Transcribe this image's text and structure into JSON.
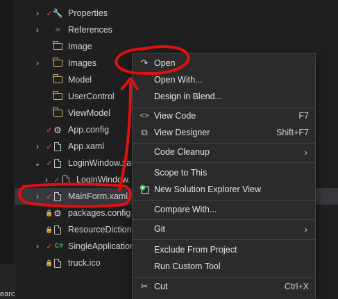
{
  "tree": {
    "items": [
      {
        "label": "Properties",
        "icon": "wrench-icon"
      },
      {
        "label": "References",
        "icon": "references-icon"
      },
      {
        "label": "Image",
        "icon": "folder-icon"
      },
      {
        "label": "Images",
        "icon": "folder-icon"
      },
      {
        "label": "Model",
        "icon": "folder-icon"
      },
      {
        "label": "UserControl",
        "icon": "folder-icon"
      },
      {
        "label": "ViewModel",
        "icon": "folder-icon"
      },
      {
        "label": "App.config",
        "icon": "config-icon"
      },
      {
        "label": "App.xaml",
        "icon": "xaml-file-icon"
      },
      {
        "label": "LoginWindow.xan",
        "icon": "xaml-file-icon"
      },
      {
        "label": "LoginWindow.",
        "icon": "xaml-file-icon"
      },
      {
        "label": "MainForm.xaml",
        "icon": "xaml-file-icon"
      },
      {
        "label": "packages.config",
        "icon": "config-icon"
      },
      {
        "label": "ResourceDictiona",
        "icon": "xaml-file-icon"
      },
      {
        "label": "SingleApplication",
        "icon": "csharp-file-icon"
      },
      {
        "label": "truck.ico",
        "icon": "image-file-icon"
      }
    ],
    "chevron": "›",
    "chevron_open": "⌄",
    "check_glyph": "✓",
    "lock_glyph": "🔒",
    "cs_glyph": "C#"
  },
  "rail": {
    "text": "earc"
  },
  "context_menu": {
    "items": [
      {
        "label": "Open",
        "icon": "open-arrow-icon",
        "glyph": "↷",
        "shortcut": ""
      },
      {
        "label": "Open With...",
        "icon": "",
        "glyph": "",
        "shortcut": ""
      },
      {
        "label": "Design in Blend...",
        "icon": "",
        "glyph": "",
        "shortcut": ""
      },
      {
        "label": "View Code",
        "icon": "code-icon",
        "glyph": "<>",
        "shortcut": "F7"
      },
      {
        "label": "View Designer",
        "icon": "designer-icon",
        "glyph": "⧉",
        "shortcut": "Shift+F7"
      },
      {
        "label": "Code Cleanup",
        "icon": "",
        "glyph": "",
        "shortcut": "",
        "submenu": "›"
      },
      {
        "label": "Scope to This",
        "icon": "",
        "glyph": "",
        "shortcut": ""
      },
      {
        "label": "New Solution Explorer View",
        "icon": "new-view-icon",
        "glyph": "",
        "shortcut": ""
      },
      {
        "label": "Compare With...",
        "icon": "",
        "glyph": "",
        "shortcut": ""
      },
      {
        "label": "Git",
        "icon": "",
        "glyph": "",
        "shortcut": "",
        "submenu": "›"
      },
      {
        "label": "Exclude From Project",
        "icon": "",
        "glyph": "",
        "shortcut": ""
      },
      {
        "label": "Run Custom Tool",
        "icon": "",
        "glyph": "",
        "shortcut": ""
      },
      {
        "label": "Cut",
        "icon": "scissors-icon",
        "glyph": "✂",
        "shortcut": "Ctrl+X"
      }
    ]
  },
  "colors": {
    "background": "#1f1f1f",
    "menu_background": "#2b2b2b",
    "annotation_red": "#e01010",
    "check_red": "#e5534b",
    "folder_yellow": "#dcb67a",
    "lock_blue": "#3b9cff",
    "csharp_green": "#3fb950"
  }
}
